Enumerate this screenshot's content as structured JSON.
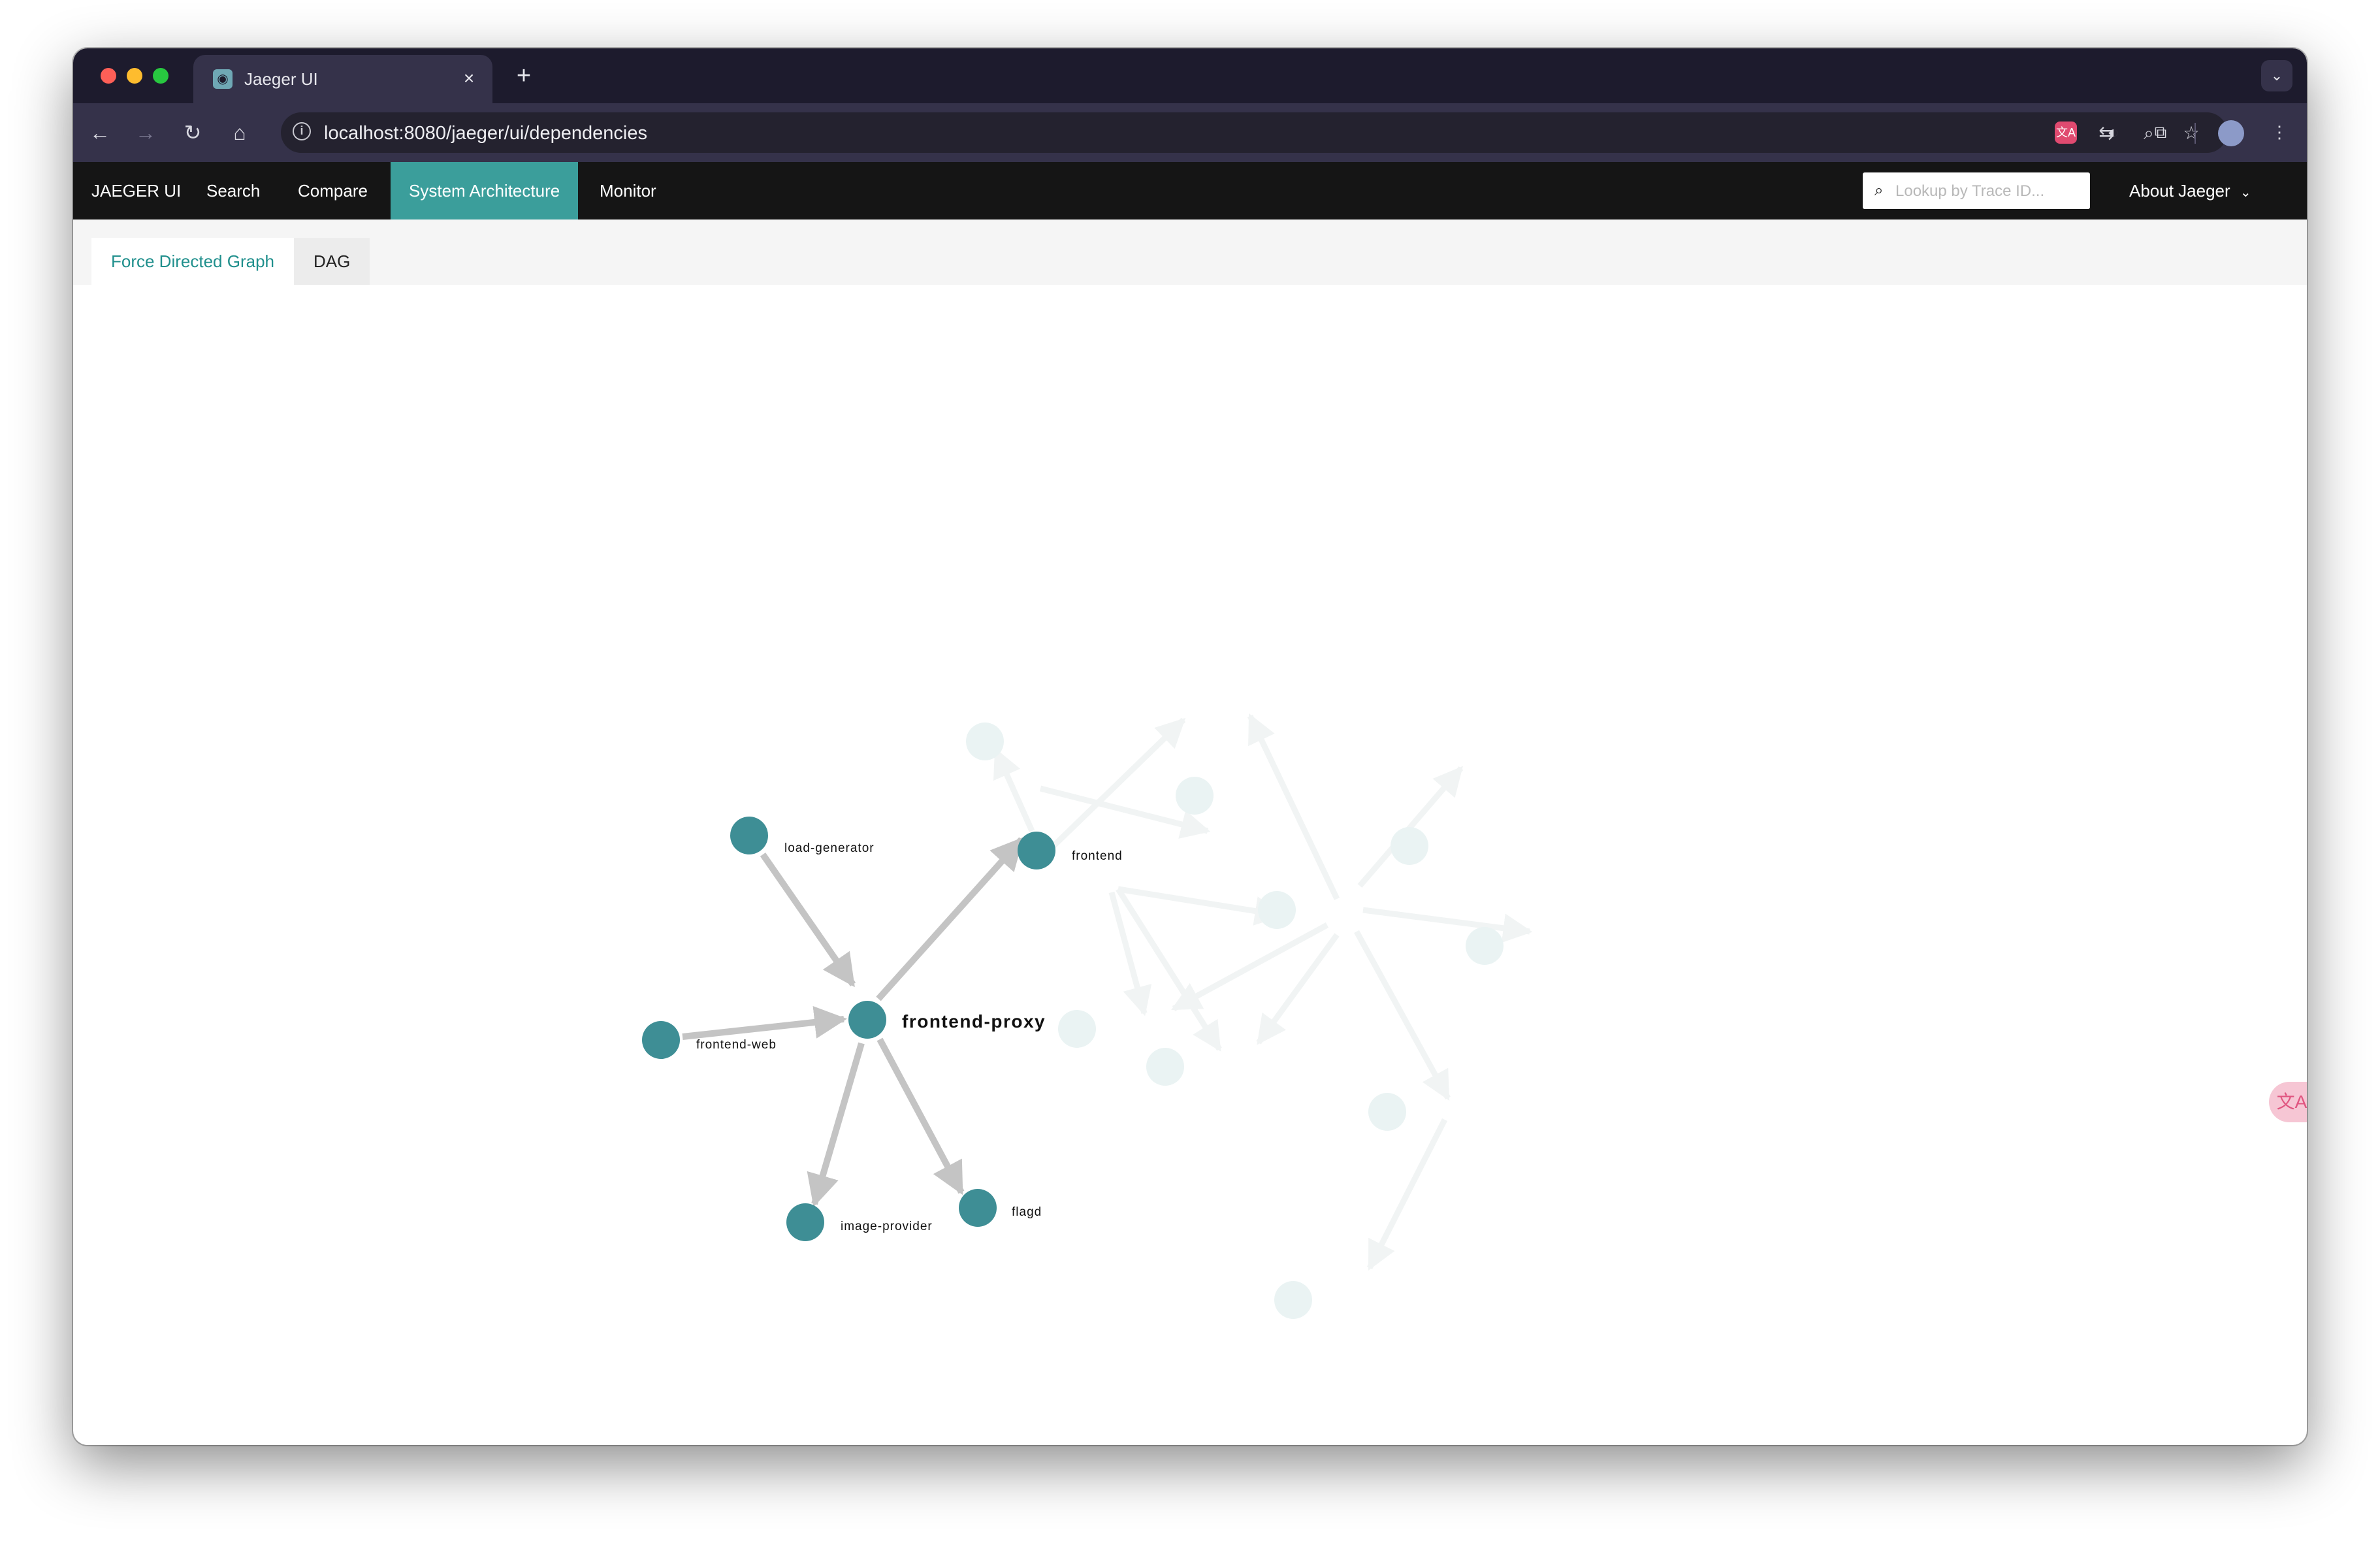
{
  "browser": {
    "tab_title": "Jaeger UI",
    "tab_close_icon": "×",
    "new_tab_icon": "+",
    "url": "localhost:8080/jaeger/ui/dependencies"
  },
  "nav": {
    "brand": "JAEGER UI",
    "items": [
      {
        "label": "Search"
      },
      {
        "label": "Compare"
      },
      {
        "label": "System Architecture",
        "active": true
      },
      {
        "label": "Monitor"
      }
    ],
    "lookup_placeholder": "Lookup by Trace ID...",
    "about": "About Jaeger"
  },
  "subtabs": [
    {
      "label": "Force Directed Graph",
      "active": true
    },
    {
      "label": "DAG"
    }
  ],
  "graph": {
    "node_color": "#3e8e95",
    "faded_node_color": "#eaf3f3",
    "edge_color": "#c4c4c4",
    "focus": "frontend-proxy",
    "services": [
      "load-generator",
      "frontend",
      "frontend-proxy",
      "frontend-web",
      "image-provider",
      "flagd"
    ]
  }
}
